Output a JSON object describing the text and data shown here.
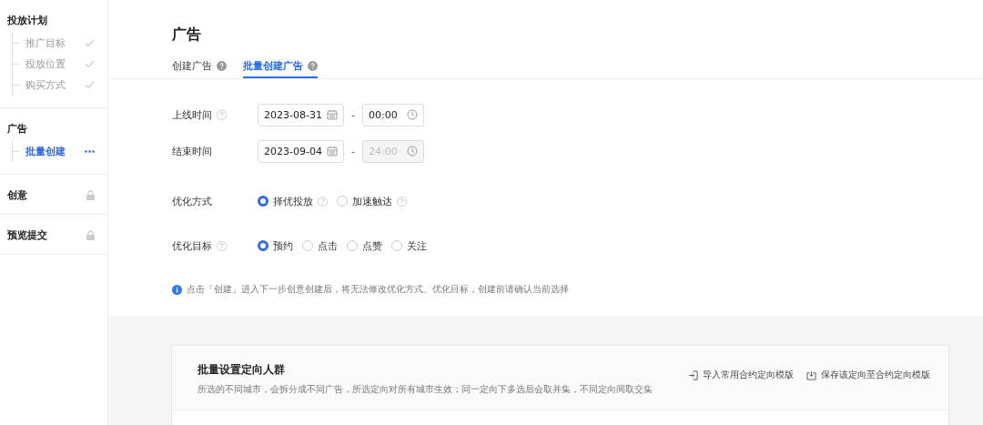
{
  "sidebar": {
    "groups": [
      {
        "title": "投放计划",
        "locked": false,
        "items": [
          {
            "label": "推广目标",
            "done": true,
            "selected": false
          },
          {
            "label": "投放位置",
            "done": true,
            "selected": false
          },
          {
            "label": "购买方式",
            "done": true,
            "selected": false
          }
        ]
      },
      {
        "title": "广告",
        "locked": false,
        "items": [
          {
            "label": "批量创建",
            "done": false,
            "selected": true
          }
        ]
      },
      {
        "title": "创意",
        "locked": true
      },
      {
        "title": "预览提交",
        "locked": true
      }
    ]
  },
  "page_title": "广告",
  "tabs": [
    {
      "label": "创建广告",
      "selected": false
    },
    {
      "label": "批量创建广告",
      "selected": true
    }
  ],
  "fields": [
    {
      "kind": "datetime",
      "label": "上线时间",
      "help": true,
      "date": "2023-08-31",
      "time": "00:00",
      "time_disabled": false
    },
    {
      "kind": "datetime",
      "label": "结束时间",
      "help": false,
      "date": "2023-09-04",
      "time": "24:00",
      "time_disabled": true
    },
    {
      "kind": "radio",
      "label": "优化方式",
      "help": false,
      "options": [
        {
          "label": "择优投放",
          "help": true,
          "selected": true
        },
        {
          "label": "加速触达",
          "help": true,
          "selected": false
        }
      ]
    },
    {
      "kind": "radio",
      "label": "优化目标",
      "help": true,
      "options": [
        {
          "label": "预约",
          "help": false,
          "selected": true
        },
        {
          "label": "点击",
          "help": false,
          "selected": false
        },
        {
          "label": "点赞",
          "help": false,
          "selected": false
        },
        {
          "label": "关注",
          "help": false,
          "selected": false
        }
      ]
    }
  ],
  "separator": "-",
  "notice": "点击「创建」进入下一步创意创建后，将无法修改优化方式、优化目标，创建前请确认当前选择",
  "card": {
    "title": "批量设置定向人群",
    "description": "所选的不同城市，会拆分成不同广告，所选定向对所有城市生效；同一定向下多选后会取并集，不同定向间取交集",
    "actions": [
      {
        "kind": "import",
        "label": "导入常用合约定向模版"
      },
      {
        "kind": "save",
        "label": "保存该定向至合约定向模版"
      }
    ]
  }
}
